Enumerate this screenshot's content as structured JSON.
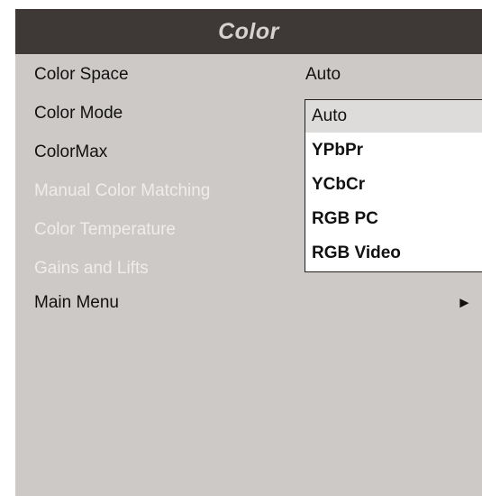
{
  "header": {
    "title": "Color"
  },
  "menu": {
    "items": [
      {
        "label": "Color Space",
        "enabled": true
      },
      {
        "label": "Color Mode",
        "enabled": true
      },
      {
        "label": "ColorMax",
        "enabled": true
      },
      {
        "label": "Manual Color Matching",
        "enabled": false
      },
      {
        "label": "Color Temperature",
        "enabled": false
      },
      {
        "label": "Gains and Lifts",
        "enabled": false
      },
      {
        "label": "Main Menu",
        "enabled": true
      }
    ],
    "color_space_value": "Auto",
    "submenu_arrow": "►"
  },
  "dropdown": {
    "selected": "Auto",
    "options": [
      "Auto",
      "YPbPr",
      "YCbCr",
      "RGB PC",
      "RGB Video"
    ]
  },
  "colors": {
    "header_bg": "#3e3936",
    "header_text": "#d6d2cf",
    "panel_bg": "#cdc9c6",
    "disabled_text": "#efecea"
  }
}
